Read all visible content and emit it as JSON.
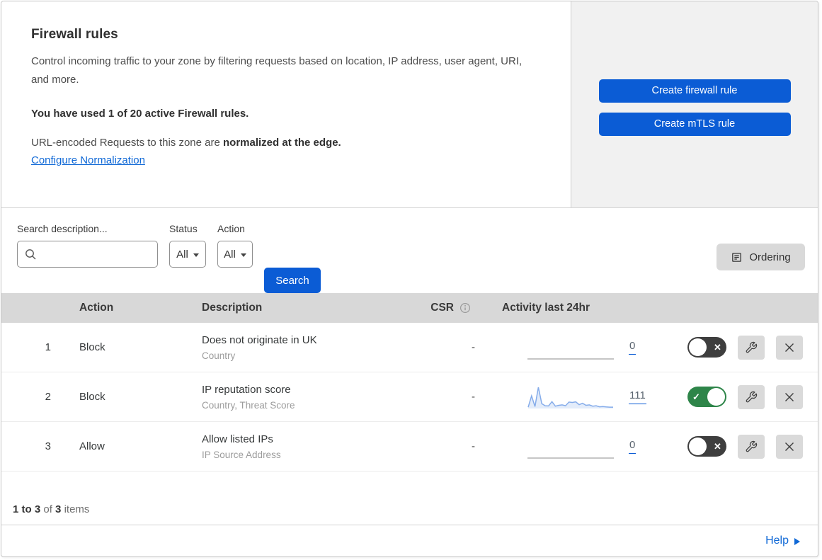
{
  "colors": {
    "accent": "#0b5cd5",
    "link": "#0f68d6",
    "toggle_on": "#2e8549",
    "toggle_off": "#3e3e3e",
    "spark_line": "#85acea",
    "spark_fill": "#e3ecfa"
  },
  "header": {
    "title": "Firewall rules",
    "description": "Control incoming traffic to your zone by filtering requests based on location, IP address, user agent, URI, and more.",
    "usage_bold": "You have used 1 of 20 active Firewall rules.",
    "normalization_prefix": "URL-encoded Requests to this zone are ",
    "normalization_bold": "normalized at the edge.",
    "normalization_link": "Configure Normalization",
    "create_firewall_button": "Create firewall rule",
    "create_mtls_button": "Create mTLS rule"
  },
  "filters": {
    "search_label": "Search description...",
    "search_value": "",
    "status_label": "Status",
    "status_value": "All",
    "action_label": "Action",
    "action_value": "All",
    "search_button": "Search",
    "ordering_button": "Ordering"
  },
  "table": {
    "columns": {
      "action": "Action",
      "description": "Description",
      "csr": "CSR",
      "activity": "Activity last 24hr"
    },
    "rows": [
      {
        "index": "1",
        "action": "Block",
        "description": "Does not originate in UK",
        "criteria": "Country",
        "csr": "-",
        "count": "0",
        "enabled": false,
        "sparkline": []
      },
      {
        "index": "2",
        "action": "Block",
        "description": "IP reputation score",
        "criteria": "Country, Threat Score",
        "csr": "-",
        "count": "111",
        "enabled": true,
        "sparkline": [
          3,
          58,
          6,
          100,
          20,
          10,
          9,
          30,
          8,
          12,
          14,
          10,
          28,
          26,
          29,
          15,
          22,
          12,
          14,
          8,
          10,
          5,
          6,
          4,
          3,
          3
        ]
      },
      {
        "index": "3",
        "action": "Allow",
        "description": "Allow listed IPs",
        "criteria": "IP Source Address",
        "csr": "-",
        "count": "0",
        "enabled": false,
        "sparkline": []
      }
    ]
  },
  "footer": {
    "range_bold": "1 to 3",
    "of_text": "of",
    "total_bold": "3",
    "items_text": "items",
    "help_label": "Help"
  }
}
